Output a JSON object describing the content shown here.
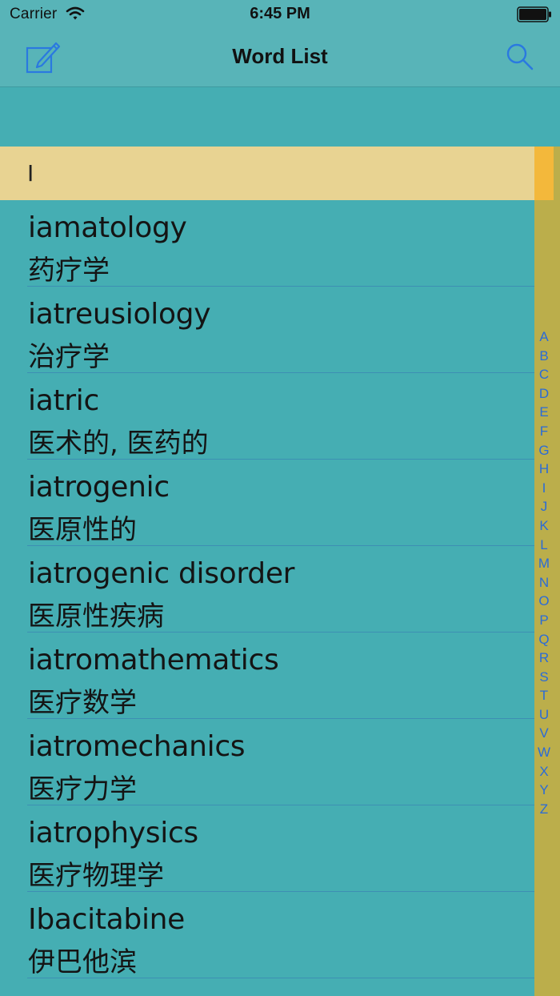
{
  "status_bar": {
    "carrier": "Carrier",
    "time": "6:45 PM"
  },
  "nav": {
    "title": "Word List"
  },
  "section": {
    "label": "I"
  },
  "words": [
    {
      "word": "iamatology",
      "meaning": "药疗学"
    },
    {
      "word": "iatreusiology",
      "meaning": "治疗学"
    },
    {
      "word": "iatric",
      "meaning": "医术的, 医药的"
    },
    {
      "word": "iatrogenic",
      "meaning": "医原性的"
    },
    {
      "word": "iatrogenic disorder",
      "meaning": "医原性疾病"
    },
    {
      "word": "iatromathematics",
      "meaning": "医疗数学"
    },
    {
      "word": "iatromechanics",
      "meaning": "医疗力学"
    },
    {
      "word": "iatrophysics",
      "meaning": "医疗物理学"
    },
    {
      "word": "Ibacitabine",
      "meaning": "伊巴他滨"
    }
  ],
  "index_letters": [
    "A",
    "B",
    "C",
    "D",
    "E",
    "F",
    "G",
    "H",
    "I",
    "J",
    "K",
    "L",
    "M",
    "N",
    "O",
    "P",
    "Q",
    "R",
    "S",
    "T",
    "U",
    "V",
    "W",
    "X",
    "Y",
    "Z"
  ],
  "colors": {
    "background": "#45aeb3",
    "navbar": "#58b4b8",
    "section_header": "#e8d392",
    "index_bar": "#bbae4b",
    "index_highlight": "#f3b83b",
    "accent_blue": "#2a6bd8"
  }
}
